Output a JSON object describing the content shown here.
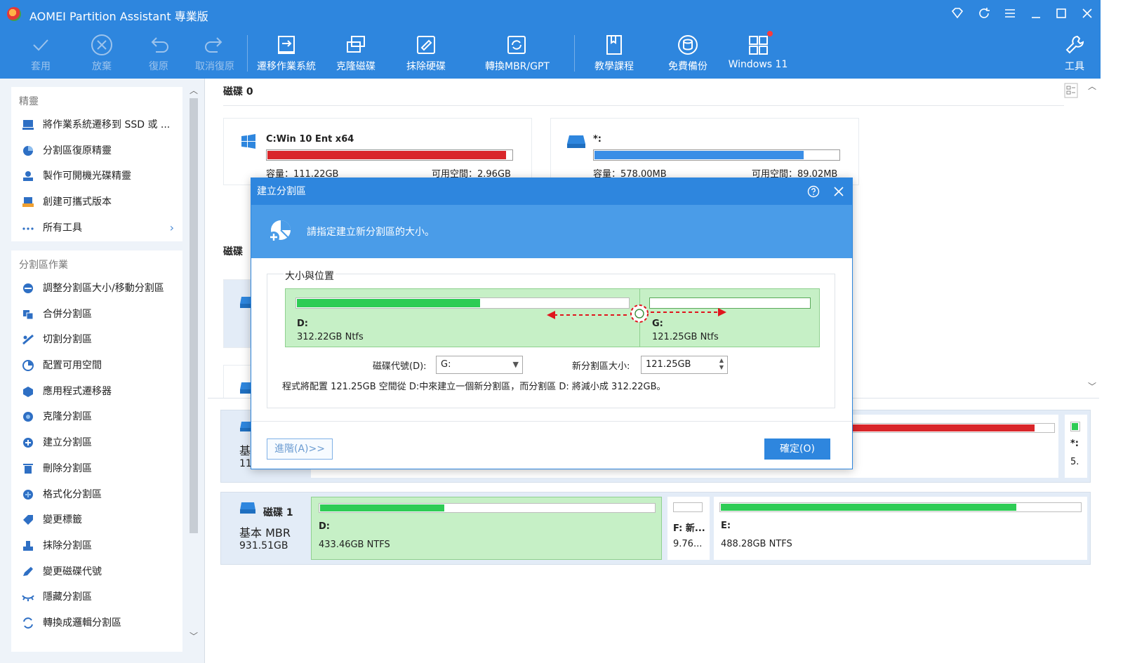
{
  "app": {
    "title": "AOMEI Partition Assistant 專業版"
  },
  "toolbar": {
    "apply": "套用",
    "discard": "放棄",
    "undo": "復原",
    "redo": "取消復原",
    "migrate_os": "遷移作業系統",
    "clone_disk": "克隆磁碟",
    "wipe_disk": "抹除硬碟",
    "convert_mbr_gpt": "轉換MBR/GPT",
    "tutorial": "教學課程",
    "free_backup": "免費備份",
    "windows11": "Windows 11",
    "tools": "工具"
  },
  "sidebar": {
    "wizards_title": "精靈",
    "wizards": [
      {
        "label": "將作業系統遷移到 SSD 或 ..."
      },
      {
        "label": "分割區復原精靈"
      },
      {
        "label": "製作可開機光碟精靈"
      },
      {
        "label": "創建可攜式版本"
      },
      {
        "label": "所有工具"
      }
    ],
    "ops_title": "分割區作業",
    "ops": [
      {
        "label": "調整分割區大小/移動分割區"
      },
      {
        "label": "合併分割區"
      },
      {
        "label": "切割分割區"
      },
      {
        "label": "配置可用空間"
      },
      {
        "label": "應用程式遷移器"
      },
      {
        "label": "克隆分割區"
      },
      {
        "label": "建立分割區"
      },
      {
        "label": "刪除分割區"
      },
      {
        "label": "格式化分割區"
      },
      {
        "label": "變更標籤"
      },
      {
        "label": "抹除分割區"
      },
      {
        "label": "變更磁碟代號"
      },
      {
        "label": "隱藏分割區"
      },
      {
        "label": "轉換成邏輯分割區"
      }
    ]
  },
  "main": {
    "disk0_label": "磁碟 0",
    "disk_partial_label": "磁碟",
    "partitions": [
      {
        "name": "C:Win 10 Ent x64",
        "capacity": "容量：111.22GB",
        "free": "可用空間：2.96GB",
        "usage": 0.97,
        "color": "#d9262a"
      },
      {
        "name": "*:",
        "capacity": "容量：578.00MB",
        "free": "可用空間：89.02MB",
        "usage": 0.85,
        "color": "#3a8ee6"
      }
    ]
  },
  "diskmap": {
    "row0": {
      "type_partial": "基",
      "size_partial": "11",
      "small_label": "*:",
      "small_size": "5."
    },
    "disk1": {
      "title": "磁碟 1",
      "type": "基本 MBR",
      "size": "931.51GB",
      "segments": [
        {
          "name": "D:",
          "info": "433.46GB NTFS",
          "usage": 0.37
        },
        {
          "name": "F: 新...",
          "info": "9.76...",
          "usage": 0.0
        },
        {
          "name": "E:",
          "info": "488.28GB NTFS",
          "usage": 0.82
        }
      ]
    }
  },
  "dialog": {
    "title": "建立分割區",
    "header_text": "請指定建立新分割區的大小。",
    "group_title": "大小與位置",
    "left_part": {
      "name": "D:",
      "info": "312.22GB Ntfs",
      "usage": 0.55
    },
    "right_part": {
      "name": "G:",
      "info": "121.25GB Ntfs"
    },
    "drive_letter_label": "磁碟代號(D):",
    "drive_letter_value": "G:",
    "new_size_label": "新分割區大小:",
    "new_size_value": "121.25GB",
    "description": "程式將配置 121.25GB 空間從 D:中來建立一個新分割區，而分割區 D: 將減小成 312.22GB。",
    "advanced_button": "進階(A)>>",
    "ok_button": "確定(O)"
  },
  "colors": {
    "accent": "#2e86de",
    "used_red": "#d9262a",
    "used_green": "#2ecc55",
    "selected_green": "#c6f0c6"
  }
}
